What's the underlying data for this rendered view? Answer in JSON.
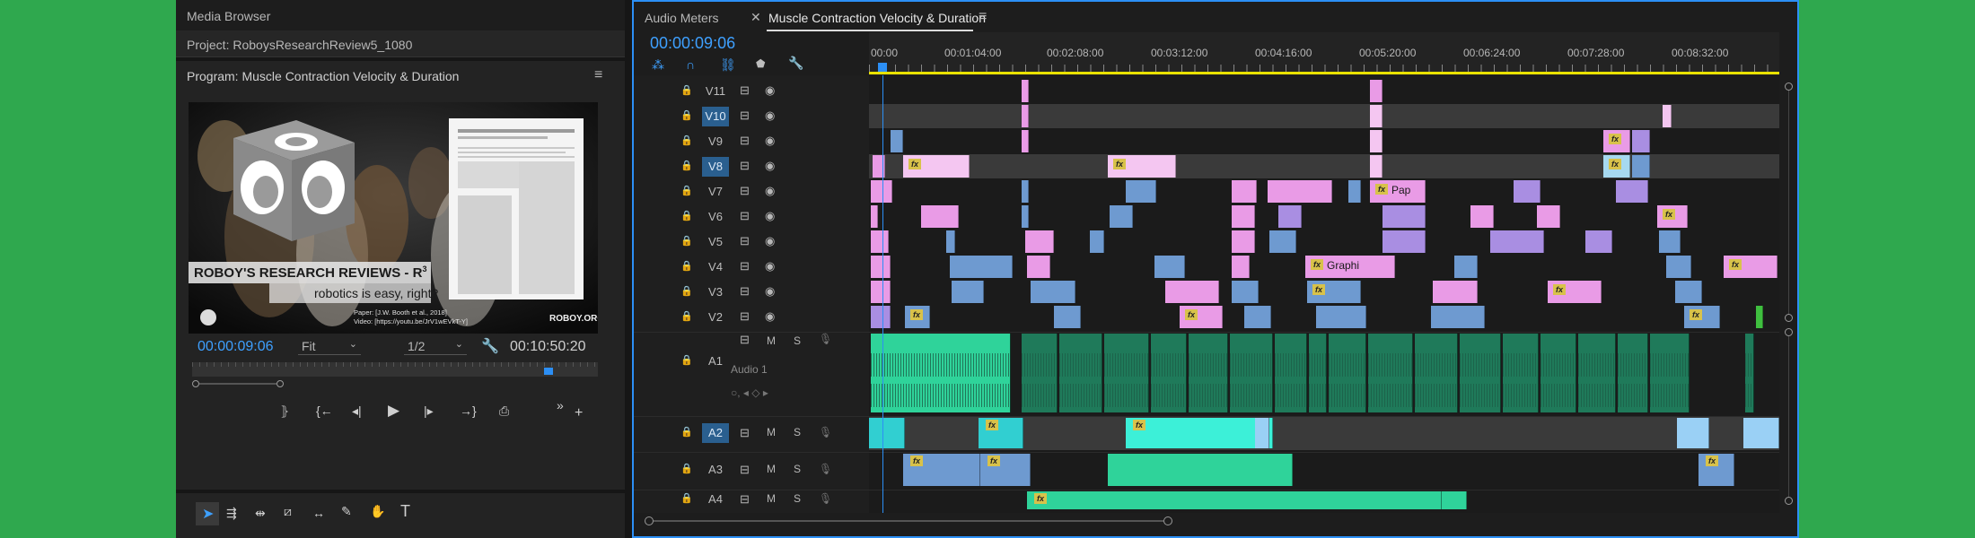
{
  "media_browser": {
    "title": "Media Browser",
    "project": "Project: RoboysResearchReview5_1080"
  },
  "program": {
    "title": "Program: Muscle Contraction Velocity & Duration",
    "overlay_line1": "ROBOY'S RESEARCH REVIEWS - R",
    "overlay_sup": "3",
    "overlay_line2": "robotics is easy, right?",
    "paper_ref": "Paper: [J.W. Booth et al., 2018]",
    "video_ref": "Video: [https://youtu.be/JrV1wEVkT-Y]",
    "watermark": "ROBOY.ORG",
    "timecode": "00:00:09:06",
    "fit": "Fit",
    "resolution": "1/2",
    "duration": "00:10:50:20"
  },
  "tabs": {
    "audio_meters": "Audio Meters",
    "sequence": "Muscle Contraction Velocity & Duration"
  },
  "timeline": {
    "timecode": "00:00:09:06",
    "ruler": [
      "00:00",
      "00:01:04:00",
      "00:02:08:00",
      "00:03:12:00",
      "00:04:16:00",
      "00:05:20:00",
      "00:06:24:00",
      "00:07:28:00",
      "00:08:32:00"
    ],
    "video_tracks": [
      "V11",
      "V10",
      "V9",
      "V8",
      "V7",
      "V6",
      "V5",
      "V4",
      "V3",
      "V2"
    ],
    "audio_tracks": [
      "A1",
      "A2",
      "A3",
      "A4"
    ],
    "audio1_name": "Audio 1",
    "clip_labels": {
      "pap": "Pap",
      "graphi": "Graphi"
    },
    "m": "M",
    "s": "S"
  },
  "tools": [
    "selection-tool",
    "track-select-tool",
    "ripple-edit-tool",
    "razor-tool",
    "slip-tool",
    "pen-tool",
    "hand-tool",
    "type-tool"
  ],
  "colors": {
    "accent": "#2c8ff5",
    "pink": "#e99be6",
    "lightpink": "#f4c6f1",
    "purple": "#a98ee2",
    "blue": "#6e9ad0",
    "teal": "#2fd39a",
    "audio": "#1f7a5a"
  }
}
